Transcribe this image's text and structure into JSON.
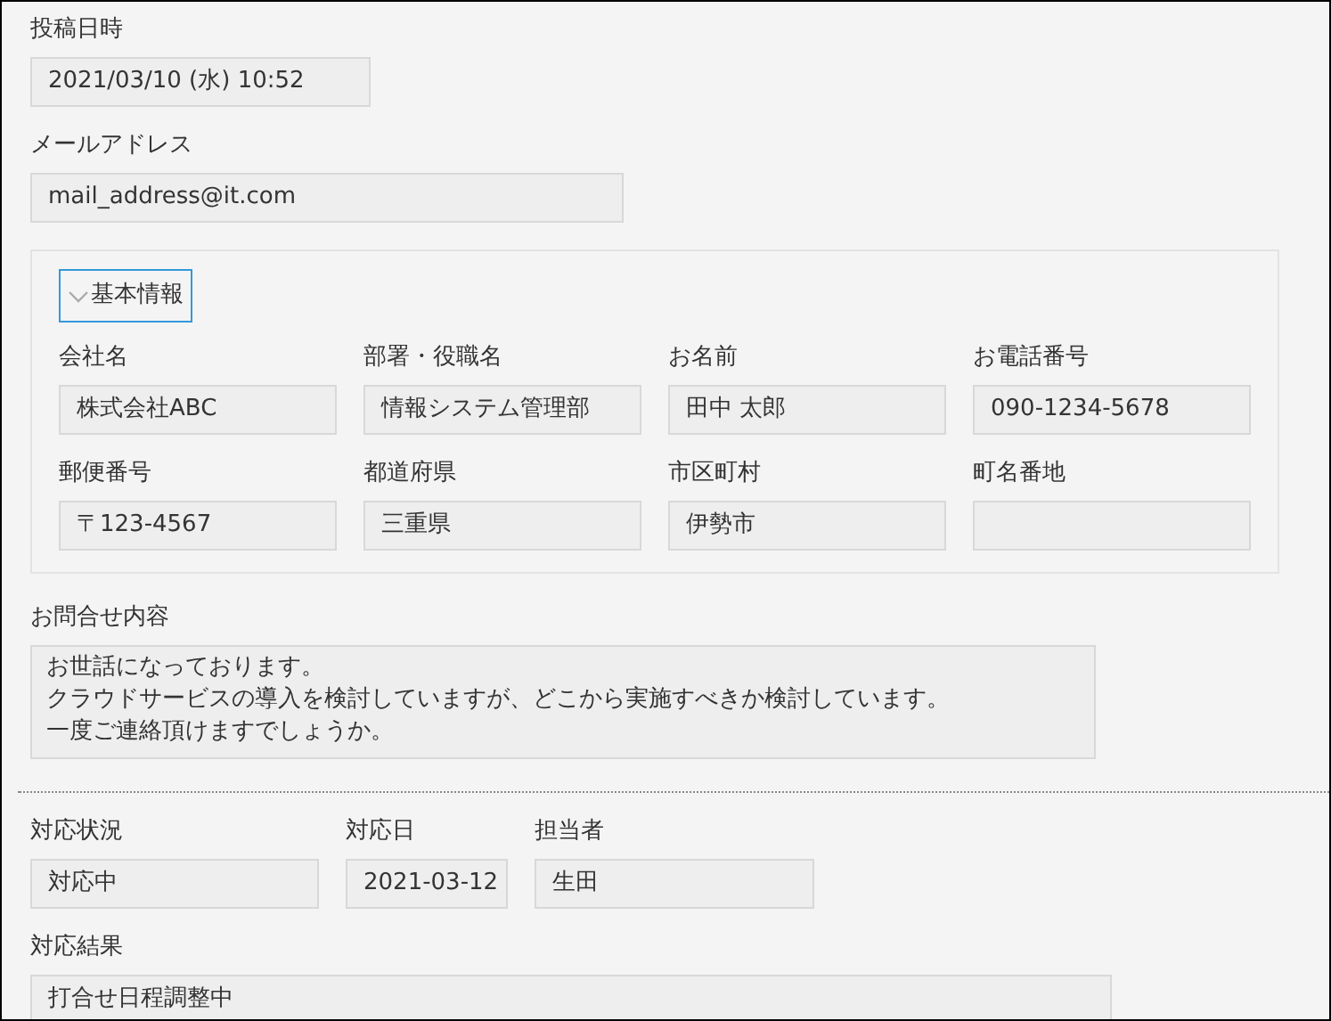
{
  "posted_at": {
    "label": "投稿日時",
    "value": "2021/03/10 (水) 10:52"
  },
  "email": {
    "label": "メールアドレス",
    "value": "mail_address@it.com"
  },
  "basic_info": {
    "title": "基本情報",
    "expanded": true,
    "fields": [
      {
        "label": "会社名",
        "value": "株式会社ABC"
      },
      {
        "label": "部署・役職名",
        "value": "情報システム管理部"
      },
      {
        "label": "お名前",
        "value": "田中 太郎"
      },
      {
        "label": "お電話番号",
        "value": "090-1234-5678"
      },
      {
        "label": "郵便番号",
        "value": "〒123-4567"
      },
      {
        "label": "都道府県",
        "value": "三重県"
      },
      {
        "label": "市区町村",
        "value": "伊勢市"
      },
      {
        "label": "町名番地"
      }
    ]
  },
  "inquiry": {
    "label": "お問合せ内容",
    "lines": [
      "お世話になっております。",
      "クラウドサービスの導入を検討していますが、どこから実施すべきか検討しています。",
      "一度ご連絡頂けますでしょうか。"
    ]
  },
  "response": {
    "fields": [
      {
        "label": "対応状況",
        "value": "対応中"
      },
      {
        "label": "対応日",
        "value": "2021-03-12"
      },
      {
        "label": "担当者",
        "value": "生田"
      }
    ]
  },
  "result": {
    "label": "対応結果",
    "value": "打合せ日程調整中"
  }
}
